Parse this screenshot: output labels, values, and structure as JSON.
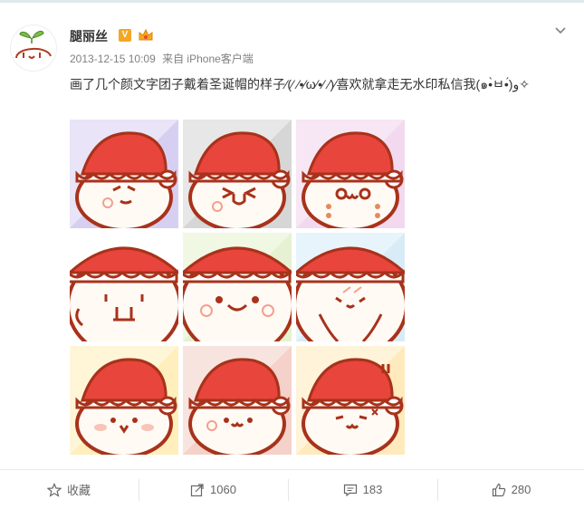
{
  "post": {
    "username": "腿丽丝",
    "v_badge": "V",
    "timestamp": "2013-12-15 10:09",
    "source": "来自 iPhone客户端",
    "text": "画了几个颜文字团子戴着圣诞帽的样子⁄(⁄ ⁄•⁄ω⁄•⁄ ⁄)⁄喜欢就拿走无水印私信我(๑•̀ㅂ•́)و✧",
    "images": [
      {
        "face": "smirk",
        "bg": "#e9e4f7",
        "accent": "#cfc6ef"
      },
      {
        "face": "wink",
        "bg": "#e7e7e7",
        "accent": "#cfcfcf"
      },
      {
        "face": "owo",
        "bg": "#f7e6f4",
        "accent": "#f0d3ec"
      },
      {
        "face": "flat",
        "bg": "#ffffff",
        "accent": "#ffffff"
      },
      {
        "face": "smile",
        "bg": "#f0f7e3",
        "accent": "#dfeecb"
      },
      {
        "face": "cry",
        "bg": "#e8f4fb",
        "accent": "#d2e8f5"
      },
      {
        "face": "cheek",
        "bg": "#fff6d8",
        "accent": "#ffecb0"
      },
      {
        "face": "dots",
        "bg": "#f8e4de",
        "accent": "#f2cbc0"
      },
      {
        "face": "angry",
        "bg": "#fff3d9",
        "accent": "#ffe6b0"
      }
    ]
  },
  "actions": {
    "favorite": {
      "label": "收藏",
      "icon": "star-icon"
    },
    "repost": {
      "label": "1060",
      "icon": "repost-icon"
    },
    "comment": {
      "label": "183",
      "icon": "comment-icon"
    },
    "like": {
      "label": "280",
      "icon": "thumb-up-icon"
    }
  },
  "colors": {
    "hat_red": "#e8453c",
    "outline": "#a8321b",
    "blush": "#f3a08e",
    "meta_gray": "#808080"
  }
}
